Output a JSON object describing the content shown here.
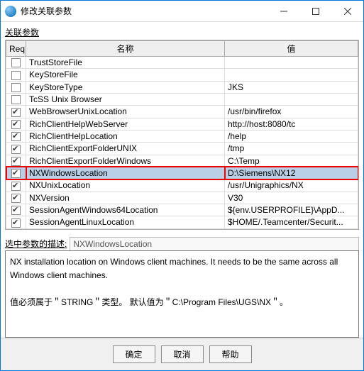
{
  "window": {
    "title": "修改关联参数"
  },
  "section": {
    "label": "关联参数"
  },
  "columns": {
    "req": "Req",
    "name": "名称",
    "value": "值"
  },
  "rows": [
    {
      "req": false,
      "name": "TrustStoreFile",
      "value": ""
    },
    {
      "req": false,
      "name": "KeyStoreFile",
      "value": ""
    },
    {
      "req": false,
      "name": "KeyStoreType",
      "value": "JKS"
    },
    {
      "req": false,
      "name": "TcSS Unix Browser",
      "value": ""
    },
    {
      "req": true,
      "name": "WebBrowserUnixLocation",
      "value": "/usr/bin/firefox"
    },
    {
      "req": true,
      "name": "RichClientHelpWebServer",
      "value": "http://host:8080/tc"
    },
    {
      "req": true,
      "name": "RichClientHelpLocation",
      "value": "/help"
    },
    {
      "req": true,
      "name": "RichClientExportFolderUNIX",
      "value": "/tmp"
    },
    {
      "req": true,
      "name": "RichClientExportFolderWindows",
      "value": "C:\\Temp"
    },
    {
      "req": true,
      "name": "NXWindowsLocation",
      "value": "D:\\Siemens\\NX12",
      "selected": true,
      "highlighted": true
    },
    {
      "req": true,
      "name": "NXUnixLocation",
      "value": "/usr/Unigraphics/NX"
    },
    {
      "req": true,
      "name": "NXVersion",
      "value": "V30"
    },
    {
      "req": true,
      "name": "SessionAgentWindows64Location",
      "value": "${env.USERPROFILE}\\AppD..."
    },
    {
      "req": true,
      "name": "SessionAgentLinuxLocation",
      "value": "$HOME/.Teamcenter/Securit..."
    }
  ],
  "description": {
    "label": "选中参数的描述:",
    "selected_name": "NXWindowsLocation",
    "body_line1": "NX installation location on Windows client machines. It needs to be the same across all Windows client machines.",
    "body_line2": "值必须属于＂STRING＂类型。 默认值为＂C:\\Program Files\\UGS\\NX＂。"
  },
  "buttons": {
    "ok": "确定",
    "cancel": "取消",
    "help": "帮助"
  }
}
